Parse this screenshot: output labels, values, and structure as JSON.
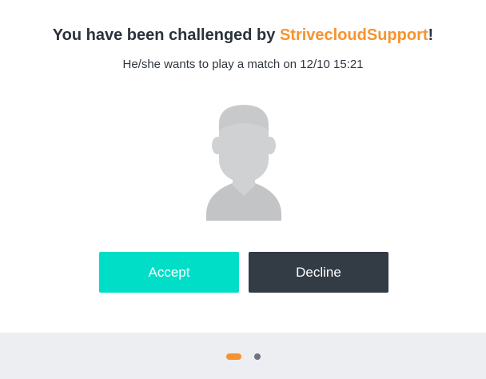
{
  "challenge": {
    "title_prefix": "You have been challenged by ",
    "challenger_name": "StrivecloudSupport",
    "title_suffix": "!",
    "subtitle": "He/she wants to play a match on 12/10 15:21"
  },
  "avatar": {
    "icon": "user-silhouette-icon"
  },
  "actions": {
    "accept_label": "Accept",
    "decline_label": "Decline"
  },
  "pager": {
    "total_pages": 2,
    "current_page": 1
  },
  "colors": {
    "accent": "#f7932f",
    "accept": "#00dec8",
    "decline": "#333b44",
    "footer_bg": "#eceef1"
  }
}
